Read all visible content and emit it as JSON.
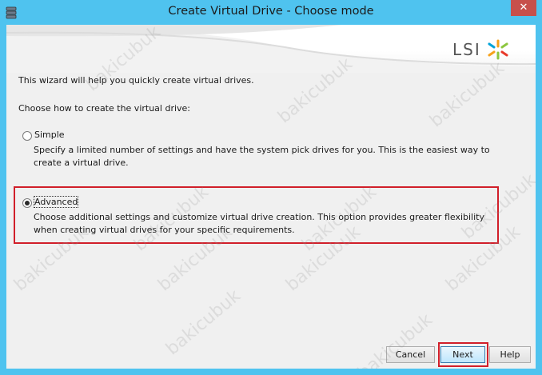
{
  "window": {
    "title": "Create Virtual Drive - Choose mode",
    "close_glyph": "✕"
  },
  "logo": {
    "text": "LSI"
  },
  "intro": "This wizard will help you quickly create virtual drives.",
  "prompt": "Choose how to create the virtual drive:",
  "options": [
    {
      "label": "Simple",
      "checked": false,
      "description": "Specify a limited number of settings and have the system pick drives for you. This is the easiest way to create a virtual drive."
    },
    {
      "label": "Advanced",
      "checked": true,
      "description": "Choose additional settings and customize virtual drive creation. This option provides greater flexibility when creating virtual drives for your specific requirements."
    }
  ],
  "buttons": {
    "cancel": "Cancel",
    "next": "Next",
    "help": "Help"
  },
  "watermark": "bakicubuk"
}
